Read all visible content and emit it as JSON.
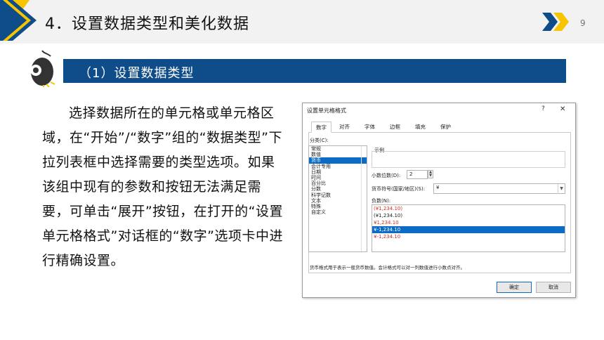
{
  "header": {
    "title": "4．设置数据类型和美化数据",
    "page_number": "9"
  },
  "section": {
    "title": "（1）设置数据类型"
  },
  "body_text": "选择数据所在的单元格或单元格区域，在“开始”/“数字”组的“数据类型”下拉列表框中选择需要的类型选项。如果该组中现有的参数和按钮无法满足需要，可单击“展开”按钮，在打开的“设置单元格格式”对话框的“数字”选项卡中进行精确设置。",
  "dialog": {
    "title": "设置单元格格式",
    "help": "?",
    "close": "✕",
    "tabs": [
      "数字",
      "对齐",
      "字体",
      "边框",
      "填充",
      "保护"
    ],
    "category_label": "分类(C):",
    "categories": [
      "常规",
      "数值",
      "货币",
      "会计专用",
      "日期",
      "时间",
      "百分比",
      "分数",
      "科学记数",
      "文本",
      "特殊",
      "自定义"
    ],
    "selected_category": 2,
    "sample_label": "示例",
    "decimal_label": "小数位数(D):",
    "decimal_value": "2",
    "currency_label": "货币符号(国家/地区)(S):",
    "currency_value": "¥",
    "negative_label": "负数(N):",
    "negative_options": [
      {
        "text": "(¥1,234.10)",
        "color": "#d03020"
      },
      {
        "text": "(¥1,234.10)",
        "color": "#222222"
      },
      {
        "text": "¥1,234.10",
        "color": "#d03020"
      },
      {
        "text": "¥-1,234.10",
        "color": "#ffffff"
      },
      {
        "text": "¥-1,234.10",
        "color": "#d03020"
      }
    ],
    "selected_negative": 3,
    "description": "货币格式用于表示一般货币数值。会计格式可以对一列数值进行小数点对齐。",
    "ok_label": "确定",
    "cancel_label": "取消"
  },
  "colors": {
    "accent_blue": "#0f4c8a",
    "accent_yellow": "#f7c500",
    "selection_blue": "#0c6cc5"
  }
}
